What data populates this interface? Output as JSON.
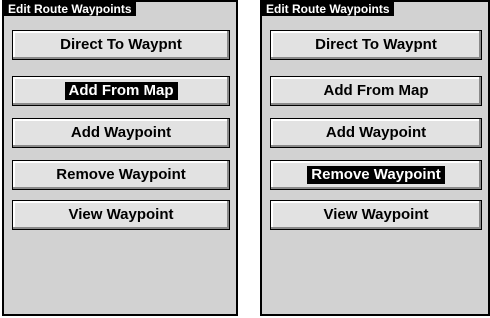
{
  "panels": [
    {
      "title": "Edit Route Waypoints",
      "buttons": [
        {
          "label": "Direct To Waypnt",
          "selected": false
        },
        {
          "label": "Add From Map",
          "selected": true
        },
        {
          "label": "Add Waypoint",
          "selected": false
        },
        {
          "label": "Remove Waypoint",
          "selected": false
        },
        {
          "label": "View Waypoint",
          "selected": false
        }
      ]
    },
    {
      "title": "Edit Route Waypoints",
      "buttons": [
        {
          "label": "Direct To Waypnt",
          "selected": false
        },
        {
          "label": "Add From Map",
          "selected": false
        },
        {
          "label": "Add Waypoint",
          "selected": false
        },
        {
          "label": "Remove Waypoint",
          "selected": true
        },
        {
          "label": "View Waypoint",
          "selected": false
        }
      ]
    }
  ]
}
